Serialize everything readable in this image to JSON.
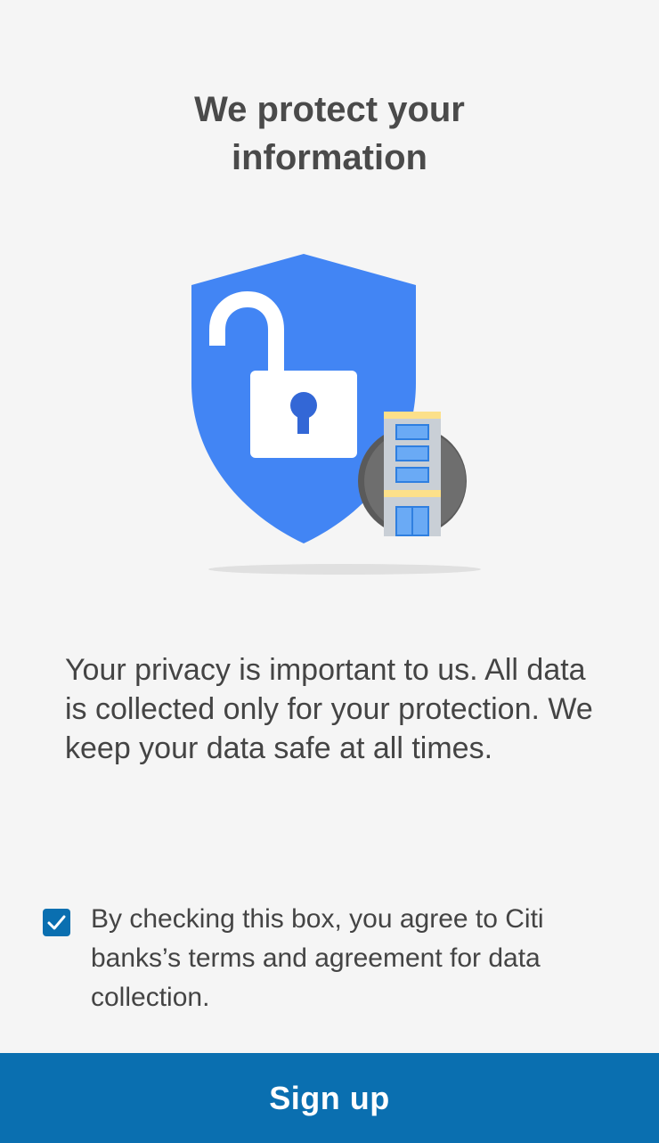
{
  "header": {
    "title": "We protect your information"
  },
  "illustration": {
    "icons": [
      "shield-icon",
      "unlocked-padlock-icon",
      "bank-building-icon"
    ],
    "colors": {
      "shield": "#4285f4",
      "padlock": "#ffffff",
      "keyhole": "#3367d6",
      "building_bg": "#666666",
      "building_stripe": "#fce08a",
      "window": "#5a9ff2"
    }
  },
  "content": {
    "privacy_text": "Your privacy is important to us. All data is collected only for your protection. We keep your data safe at all times."
  },
  "agreement": {
    "checked": true,
    "label": "By checking this box, you agree to Citi banks’s terms and agreement for data collection."
  },
  "footer": {
    "signup_label": "Sign up"
  },
  "theme": {
    "accent": "#0a6fb0",
    "background": "#f5f5f5",
    "text": "#444444"
  }
}
